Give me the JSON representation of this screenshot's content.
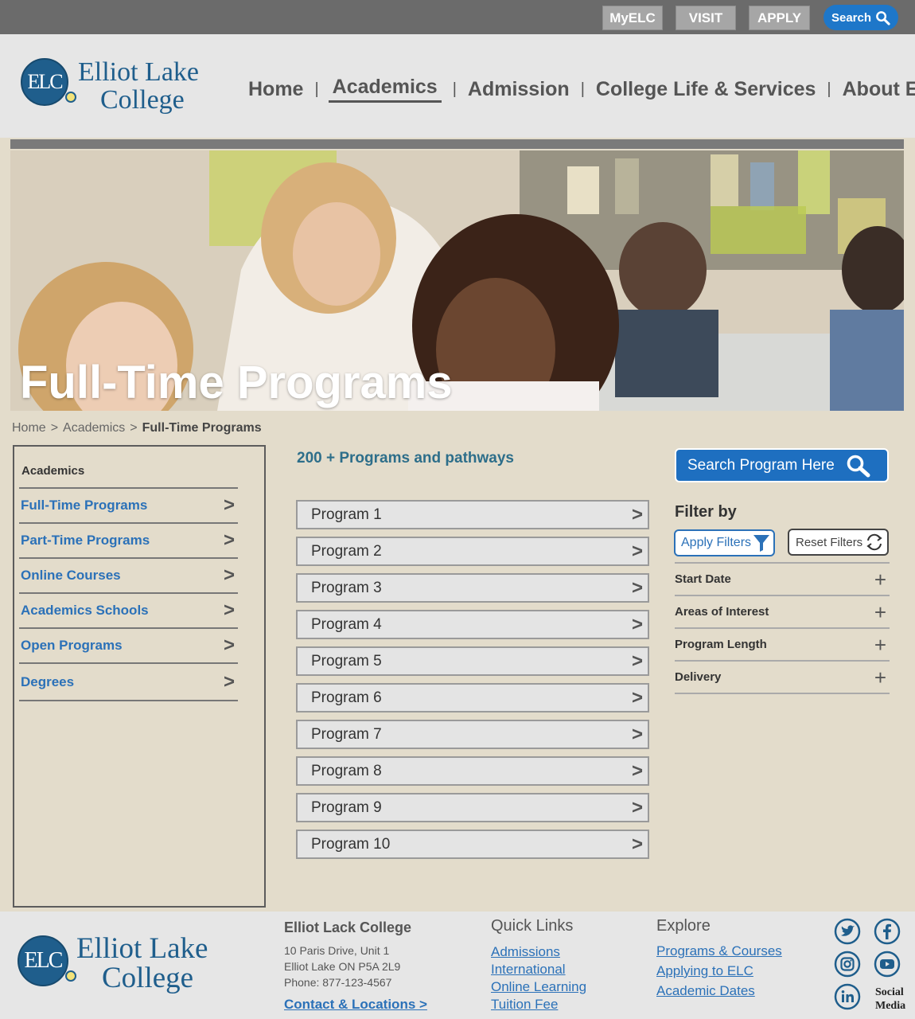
{
  "topbar": {
    "myelc": "MyELC",
    "visit": "VISIT",
    "apply": "APPLY",
    "search": "Search"
  },
  "logo": {
    "line1": "Elliot Lake",
    "line2": "College",
    "mark": "ELC"
  },
  "nav": {
    "items": [
      "Home",
      "Academics",
      "Admission",
      "College Life & Services",
      "About ELC"
    ],
    "active": "Academics"
  },
  "hero": {
    "title": "Full-Time Programs"
  },
  "breadcrumb": {
    "home": "Home",
    "academics": "Academics",
    "current": "Full-Time Programs",
    "separator": ">"
  },
  "sidebar": {
    "title": "Academics",
    "items": [
      "Full-Time Programs",
      "Part-Time Programs",
      "Online Courses",
      "Academics Schools",
      "Open Programs",
      "Degrees"
    ]
  },
  "programs": {
    "heading": "200 + Programs and pathways",
    "items": [
      "Program 1",
      "Program 2",
      "Program 3",
      "Program 4",
      "Program 5",
      "Program 6",
      "Program 7",
      "Program 8",
      "Program 9",
      "Program 10"
    ]
  },
  "filter": {
    "search_label": "Search Program Here",
    "filter_by": "Filter by",
    "apply": "Apply Filters",
    "reset": "Reset Filters",
    "rows": [
      "Start Date",
      "Areas of Interest",
      "Program Length",
      "Delivery"
    ]
  },
  "footer": {
    "college_name": "Elliot Lack College",
    "address1": "10 Paris Drive, Unit 1",
    "address2": "Elliot Lake ON P5A 2L9",
    "phone": "Phone: 877-123-4567",
    "contact": "Contact & Locations >",
    "quick_links_title": "Quick Links",
    "quick_links": [
      "Admissions",
      "International",
      "Online Learning",
      "Tuition Fee"
    ],
    "explore_title": "Explore",
    "explore_links": [
      "Programs & Courses",
      "Applying to ELC",
      "Academic Dates"
    ],
    "social_label_1": "Social",
    "social_label_2": "Media",
    "social_icons": [
      "twitter-icon",
      "facebook-icon",
      "instagram-icon",
      "youtube-icon",
      "linkedin-icon"
    ]
  },
  "colors": {
    "brand_blue": "#1f5e8c",
    "link_blue": "#2b71b8",
    "accent_blue": "#1e6fc0",
    "page_bg": "#e3dccb"
  }
}
